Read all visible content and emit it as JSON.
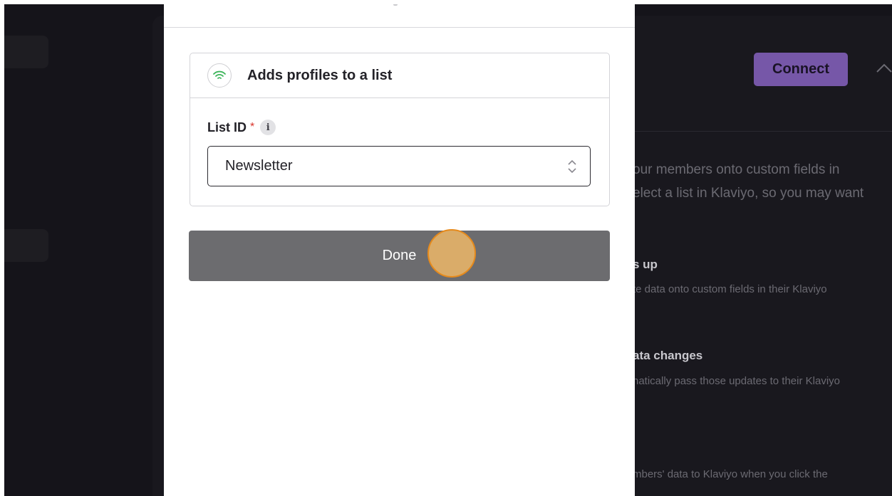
{
  "background_app": {
    "connect_label": "Connect",
    "lines": [
      "our members onto custom fields in",
      "elect a list in Klaviyo, so you may want",
      "s up",
      "te data onto custom fields in their Klaviyo",
      "ata changes",
      "natically pass those updates to their Klaviyo",
      "mbers' data to Klaviyo when you click the"
    ]
  },
  "modal": {
    "action_title": "Adds profiles to a list",
    "field_label": "List ID",
    "required_mark": "*",
    "info_glyph": "i",
    "list_value": "Newsletter",
    "done_label": "Done"
  },
  "colors": {
    "accent": "#7657a8",
    "done_button": "#6c6c6f",
    "required": "#d9342b",
    "signal_icon": "#3cb55a",
    "click_marker": "#e2b068"
  },
  "icons": [
    "signal-icon",
    "info-icon",
    "select-arrows-icon",
    "chevron-up-icon"
  ]
}
